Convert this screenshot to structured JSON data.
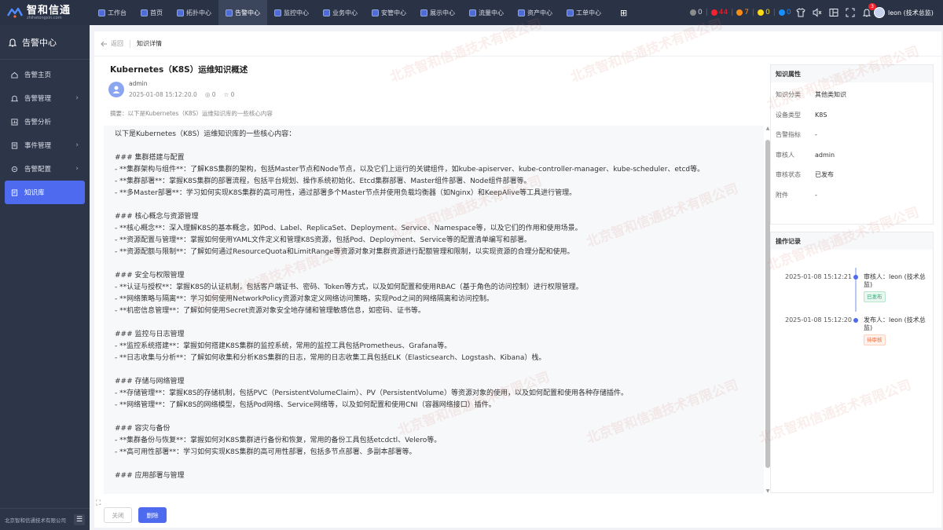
{
  "brand": {
    "name": "智和信通",
    "sub": "zhihetongxin.com"
  },
  "topnav": [
    {
      "label": "工作台",
      "active": false
    },
    {
      "label": "首页",
      "active": false
    },
    {
      "label": "拓扑中心",
      "active": false
    },
    {
      "label": "告警中心",
      "active": true
    },
    {
      "label": "监控中心",
      "active": false
    },
    {
      "label": "业务中心",
      "active": false
    },
    {
      "label": "安管中心",
      "active": false
    },
    {
      "label": "展示中心",
      "active": false
    },
    {
      "label": "流量中心",
      "active": false
    },
    {
      "label": "资产中心",
      "active": false
    },
    {
      "label": "工单中心",
      "active": false
    }
  ],
  "stats": [
    {
      "value": "0",
      "color": "#8c8c8c"
    },
    {
      "value": "44",
      "color": "#f5222d"
    },
    {
      "value": "7",
      "color": "#fa8c16"
    },
    {
      "value": "0",
      "color": "#fadb14"
    },
    {
      "value": "0",
      "color": "#1890ff"
    }
  ],
  "notifications": {
    "badge": "3"
  },
  "user": {
    "name": "leon (技术总监)"
  },
  "sidebar": {
    "title": "告警中心",
    "items": [
      {
        "label": "告警主页",
        "icon": "home-icon",
        "expandable": false,
        "active": false
      },
      {
        "label": "告警管理",
        "icon": "bell-icon",
        "expandable": true,
        "active": false
      },
      {
        "label": "告警分析",
        "icon": "chart-icon",
        "expandable": false,
        "active": false
      },
      {
        "label": "事件管理",
        "icon": "document-icon",
        "expandable": true,
        "active": false
      },
      {
        "label": "告警配置",
        "icon": "settings-icon",
        "expandable": true,
        "active": false
      },
      {
        "label": "知识库",
        "icon": "book-icon",
        "expandable": false,
        "active": true
      }
    ],
    "footer": "北京智和信通技术有限公司"
  },
  "breadcrumb": {
    "back": "返回",
    "title": "知识详情"
  },
  "article": {
    "title": "Kubernetes（K8S）运维知识概述",
    "author": "admin",
    "date": "2025-01-08 15:12:20.0",
    "views": "0",
    "stars": "0",
    "summary": "摘要：以下是Kubernetes（K8S）运维知识库的一些核心内容",
    "lines": [
      "以下是Kubernetes（K8S）运维知识库的一些核心内容：",
      "",
      "### 集群搭建与配置",
      "- **集群架构与组件**：了解K8S集群的架构，包括Master节点和Node节点，以及它们上运行的关键组件，如kube-apiserver、kube-controller-manager、kube-scheduler、etcd等。",
      "- **集群部署**：掌握K8S集群的部署流程，包括平台规划、操作系统初始化、Etcd集群部署、Master组件部署、Node组件部署等。",
      "- **多Master部署**：学习如何实现K8S集群的高可用性，通过部署多个Master节点并使用负载均衡器（如Nginx）和KeepAlive等工具进行管理。",
      "",
      "### 核心概念与资源管理",
      "- **核心概念**：深入理解K8S的基本概念，如Pod、Label、ReplicaSet、Deployment、Service、Namespace等，以及它们的作用和使用场景。",
      "- **资源配置与管理**：掌握如何使用YAML文件定义和管理K8S资源，包括Pod、Deployment、Service等的配置清单编写和部署。",
      "- **资源配额与限制**：了解如何通过ResourceQuota和LimitRange等资源对象对集群资源进行配额管理和限制，以实现资源的合理分配和使用。",
      "",
      "### 安全与权限管理",
      "- **认证与授权**：掌握K8S的认证机制，包括客户端证书、密码、Token等方式，以及如何配置和使用RBAC（基于角色的访问控制）进行权限管理。",
      "- **网络策略与隔离**：学习如何使用NetworkPolicy资源对象定义网络访问策略，实现Pod之间的网络隔离和访问控制。",
      "- **机密信息管理**：了解如何使用Secret资源对象安全地存储和管理敏感信息，如密码、证书等。",
      "",
      "### 监控与日志管理",
      "- **监控系统搭建**：掌握如何搭建K8S集群的监控系统，常用的监控工具包括Prometheus、Grafana等。",
      "- **日志收集与分析**：了解如何收集和分析K8S集群的日志，常用的日志收集工具包括ELK（Elasticsearch、Logstash、Kibana）栈。",
      "",
      "### 存储与网络管理",
      "- **存储管理**：掌握K8S的存储机制，包括PVC（PersistentVolumeClaim）、PV（PersistentVolume）等资源对象的使用，以及如何配置和使用各种存储插件。",
      "- **网络管理**：了解K8S的网络模型，包括Pod网络、Service网络等，以及如何配置和使用CNI（容器网络接口）插件。",
      "",
      "### 容灾与备份",
      "- **集群备份与恢复**：掌握如何对K8S集群进行备份和恢复，常用的备份工具包括etcdctl、Velero等。",
      "- **高可用性部署**：学习如何实现K8S集群的高可用性部署，包括多节点部署、多副本部署等。",
      "",
      "### 应用部署与管理"
    ]
  },
  "properties": {
    "title": "知识属性",
    "rows": [
      {
        "key": "知识分类",
        "value": "其他类知识"
      },
      {
        "key": "设备类型",
        "value": "K8S"
      },
      {
        "key": "告警指标",
        "value": "-"
      },
      {
        "key": "审核人",
        "value": "admin"
      },
      {
        "key": "审核状态",
        "value": "已发布"
      },
      {
        "key": "附件",
        "value": "-"
      }
    ]
  },
  "oplog": {
    "title": "操作记录",
    "entries": [
      {
        "time": "2025-01-08 15:12:21",
        "actor": "审核人：leon (技术总监)",
        "tag": "已发布",
        "tag_color": "green"
      },
      {
        "time": "2025-01-08 15:12:20",
        "actor": "发布人：leon (技术总监)",
        "tag": "待审核",
        "tag_color": "orange"
      }
    ]
  },
  "actions": {
    "close": "关闭",
    "delete": "删除"
  },
  "watermark": "北京智和信通技术有限公司"
}
